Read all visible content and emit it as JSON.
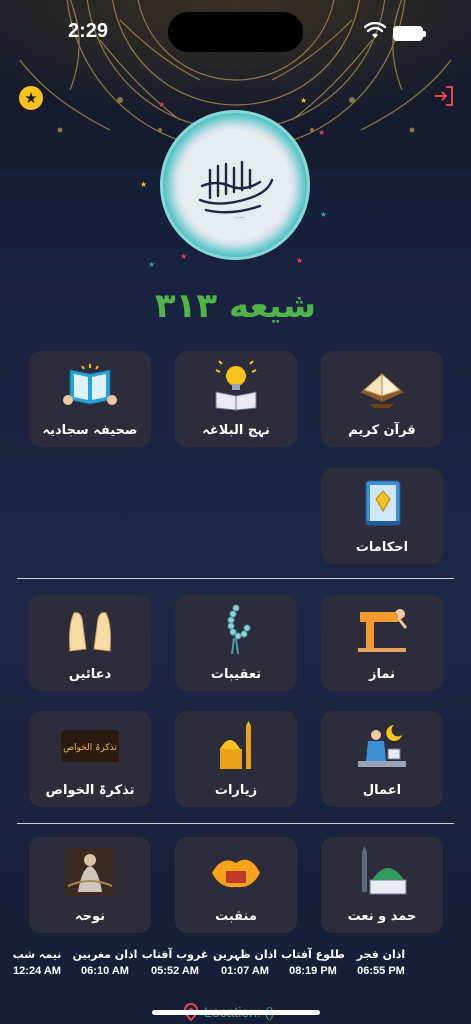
{
  "status_bar": {
    "time": "2:29"
  },
  "header": {
    "favorite_icon": "star-icon",
    "logout_icon": "logout-icon",
    "logo_text": "بسم الله الرحمن الرحیم",
    "app_title": "شیعه ۳۱۳"
  },
  "menu": {
    "row1": [
      {
        "label": "قرآن کریم",
        "icon": "quran-icon"
      },
      {
        "label": "نہج البلاغہ",
        "icon": "lightbulb-book-icon"
      },
      {
        "label": "صحیفہ سجادیہ",
        "icon": "reading-book-icon"
      }
    ],
    "row2": [
      {
        "label": "احکامات",
        "icon": "rules-book-icon"
      }
    ],
    "row3": [
      {
        "label": "نماز",
        "icon": "prayer-icon"
      },
      {
        "label": "تعقیبات",
        "icon": "tasbih-icon"
      },
      {
        "label": "دعائیں",
        "icon": "dua-hands-icon"
      }
    ],
    "row4": [
      {
        "label": "اعمال",
        "icon": "worship-icon"
      },
      {
        "label": "زیارات",
        "icon": "shrine-icon"
      },
      {
        "label": "تذکرۃ الخواص",
        "icon": "tazkira-icon",
        "badge_text": "تذکرۃ الخواص"
      }
    ],
    "row5": [
      {
        "label": "حمد و نعت",
        "icon": "mosque-icon"
      },
      {
        "label": "منقبت",
        "icon": "manqabat-icon"
      },
      {
        "label": "نوحہ",
        "icon": "nauha-icon"
      }
    ]
  },
  "prayer_times": [
    {
      "label": "اذان فجر",
      "value": "06:55 PM"
    },
    {
      "label": "طلوع آفتاب",
      "value": "08:19 PM"
    },
    {
      "label": "اذان ظہرین",
      "value": "01:07 AM"
    },
    {
      "label": "غروب آفتاب",
      "value": "05:52 AM"
    },
    {
      "label": "اذان مغربین",
      "value": "06:10 AM"
    },
    {
      "label": "نیمہ شب",
      "value": "12:24 AM"
    }
  ],
  "location": {
    "text": "Location: ()",
    "icon": "map-pin-icon"
  },
  "colors": {
    "title_green": "#4fb548",
    "tile_bg": "#2c2c3a",
    "accent_teal": "#2aa3ab",
    "star_yellow": "#f6c21b",
    "logout_red": "#e8414e"
  }
}
